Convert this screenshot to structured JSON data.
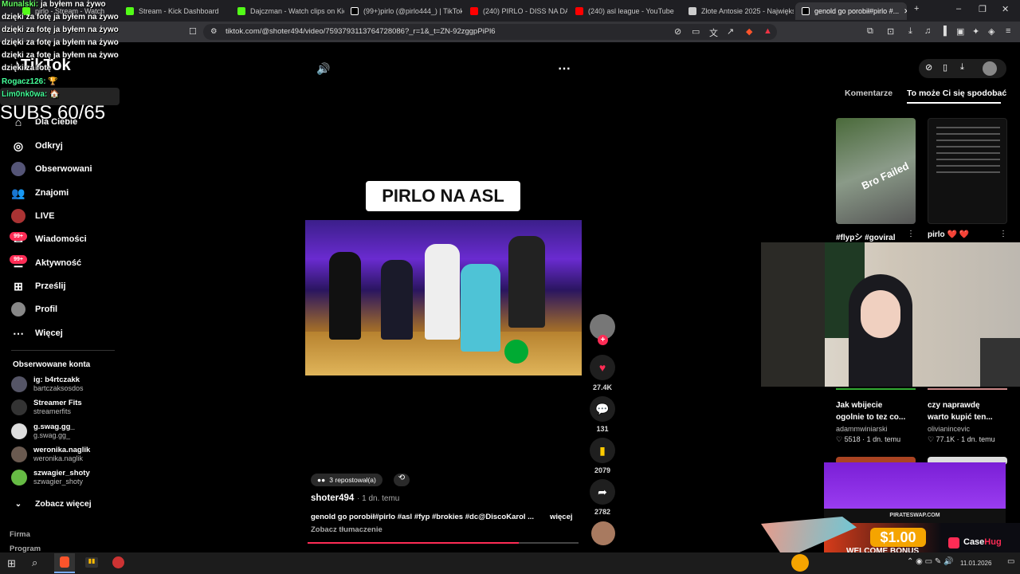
{
  "browser": {
    "tabs": [
      {
        "label": "pirlo - Stream - Watch",
        "color": "#53fc18"
      },
      {
        "label": "Stream - Kick Dashboard",
        "color": "#53fc18"
      },
      {
        "label": "Dajczman - Watch clips on Kick",
        "color": "#53fc18"
      },
      {
        "label": "(99+)pirlo (@pirlo444_) | TikTok",
        "color": "#ffffff"
      },
      {
        "label": "(240) PIRLO - DISS NA DA...",
        "color": "#ff0000"
      },
      {
        "label": "(240) asl league - YouTube",
        "color": "#ff0000"
      },
      {
        "label": "Złote Antosie 2025 - Największ...",
        "color": "#cccccc"
      },
      {
        "label": "genold go porobił#pirlo #...",
        "color": "#ffffff"
      }
    ],
    "url": "tiktok.com/@shoter494/video/7593793113764728086?_r=1&_t=ZN-92zggpPiPl6"
  },
  "overlay_chat": [
    {
      "user": "Munalski:",
      "text": "ja byłem na żywo"
    },
    {
      "user": "",
      "text": "dzięki za fotę ja byłem na żywo"
    },
    {
      "user": "",
      "text": "dzięki za fotę ja byłem na żywo"
    },
    {
      "user": "",
      "text": "dzięki za fotę ja byłem na żywo"
    },
    {
      "user": "",
      "text": "dzięki za fotę ja byłem na żywo"
    },
    {
      "user": "",
      "text": "dzięki za fotę"
    },
    {
      "user": "Rogacz126:",
      "text": "🏆"
    },
    {
      "user": "Lim0nk0wa:",
      "text": "🏠"
    }
  ],
  "overlay_subs": "SUBS 60/65",
  "logo": "TikTok",
  "sidebar": {
    "items": [
      {
        "label": "Dla Ciebie",
        "icon": "home-icon"
      },
      {
        "label": "Odkryj",
        "icon": "compass-icon"
      },
      {
        "label": "Obserwowani",
        "icon": "avatar-icon"
      },
      {
        "label": "Znajomi",
        "icon": "friends-icon"
      },
      {
        "label": "LIVE",
        "icon": "live-icon"
      },
      {
        "label": "Wiadomości",
        "icon": "messages-icon"
      },
      {
        "label": "Aktywność",
        "icon": "activity-icon"
      },
      {
        "label": "Prześlij",
        "icon": "upload-icon"
      },
      {
        "label": "Profil",
        "icon": "profile-icon"
      },
      {
        "label": "Więcej",
        "icon": "more-icon"
      }
    ],
    "badge": "99+",
    "followed_heading": "Obserwowane konta",
    "followed": [
      {
        "name": "ig: b4rtczakk",
        "handle": "bartczaksosdos"
      },
      {
        "name": "Streamer Fits",
        "handle": "streamerfits"
      },
      {
        "name": "g.swag.gg_",
        "handle": "g.swag.gg_"
      },
      {
        "name": "weronika.naglik",
        "handle": "weronika.naglik"
      },
      {
        "name": "szwagier_shoty",
        "handle": "szwagier_shoty"
      }
    ],
    "see_more": "Zobacz więcej",
    "footer": [
      "Firma",
      "Program"
    ]
  },
  "video": {
    "title_overlay": "PIRLO NA ASL",
    "reposts": "3 repostował(a)",
    "author": "shoter494",
    "age": "· 1 dn. temu",
    "caption": "genold go porobił#pirlo #asl #fyp #brokies #dc@DiscoKarol ...",
    "more": "więcej",
    "translate": "Zobacz tłumaczenie",
    "progress": 0.78
  },
  "actions": [
    {
      "icon": "heart-icon",
      "count": "27.4K"
    },
    {
      "icon": "comment-icon",
      "count": "131"
    },
    {
      "icon": "bookmark-icon",
      "count": "2079"
    },
    {
      "icon": "share-icon",
      "count": "2782"
    }
  ],
  "right_panel": {
    "tabs": [
      "Komentarze",
      "To może Ci się spodobać"
    ],
    "cards": [
      {
        "title": "#flypシ #goviral",
        "author": "",
        "likes": "",
        "age": ""
      },
      {
        "title": "pirlo ❤️ ❤️",
        "author": "",
        "likes": "",
        "age": ""
      },
      {
        "title": "Jak wbijecie ogolnie to tez co...",
        "author": "adammwiniarski",
        "likes": "♡ 5518",
        "age": "· 1 dn. temu"
      },
      {
        "title": "czy naprawdę warto kupić ten...",
        "author": "olivianincevic",
        "likes": "♡ 77.1K",
        "age": "· 1 dn. temu"
      }
    ],
    "thumb_text": "Bro Failed"
  },
  "ad": {
    "site": "PIRATESWAP.COM",
    "price": "$1.00",
    "bonus": "WELCOME BONUS",
    "brand_a": "Case",
    "brand_b": "Hug"
  },
  "taskbar": {
    "date": "11.01.2026"
  }
}
